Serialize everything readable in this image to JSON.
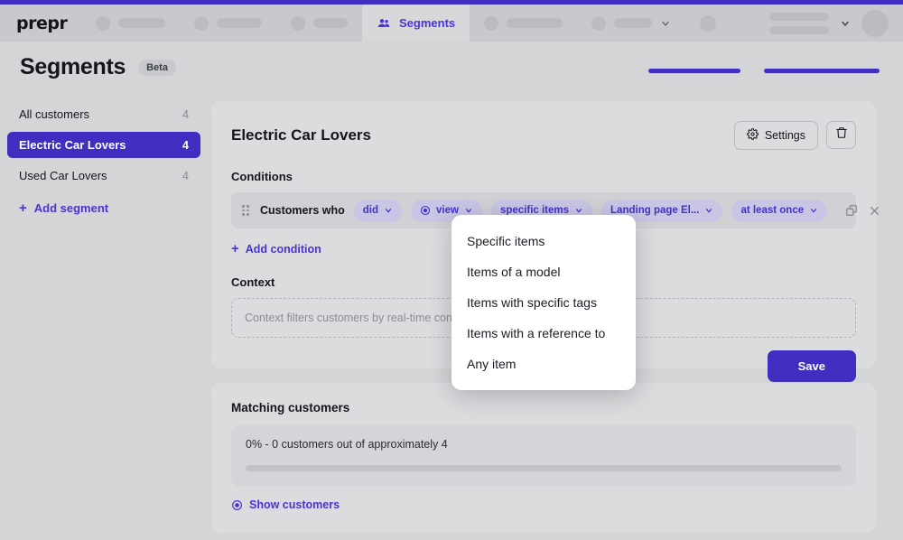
{
  "topnav": {
    "brand": "prepr",
    "active_tab": {
      "label": "Segments",
      "icon": "people-icon"
    },
    "skeleton_tabs": 3,
    "skeleton_tabs_right": 2
  },
  "header": {
    "title": "Segments",
    "badge": "Beta"
  },
  "sidebar": {
    "items": [
      {
        "label": "All customers",
        "count": "4",
        "selected": false
      },
      {
        "label": "Electric Car Lovers",
        "count": "4",
        "selected": true
      },
      {
        "label": "Used Car Lovers",
        "count": "4",
        "selected": false
      }
    ],
    "add_segment": "Add segment"
  },
  "segment_panel": {
    "name": "Electric Car Lovers",
    "settings_button": "Settings",
    "delete_button_icon": "trash-icon",
    "conditions_label": "Conditions",
    "condition": {
      "prefix": "Customers who",
      "pills": [
        {
          "label": "did",
          "icon": null
        },
        {
          "label": "view",
          "icon": "eye-icon"
        },
        {
          "label": "specific items",
          "icon": null
        },
        {
          "label": "Landing page El...",
          "icon": null
        },
        {
          "label": "at least once",
          "icon": null
        }
      ],
      "duplicate_icon": "copy-icon",
      "remove_icon": "close-icon"
    },
    "add_condition": "Add condition",
    "context_label": "Context",
    "context_placeholder": "Context filters customers by real-time conditions",
    "save_button": "Save"
  },
  "matching": {
    "title": "Matching customers",
    "summary": "0% - 0 customers out of approximately 4",
    "progress_percent": 0,
    "show_customers": "Show customers"
  },
  "dropdown": {
    "items": [
      "Specific items",
      "Items of a model",
      "Items with specific tags",
      "Items with a reference to",
      "Any item"
    ]
  },
  "colors": {
    "accent": "#3f2ec0",
    "accent_link": "#4a33d4",
    "pill_bg": "#c8c6e4",
    "pill_text": "#4432c8",
    "page_bg": "#d4d5d7",
    "card_bg": "#dbdcde"
  }
}
